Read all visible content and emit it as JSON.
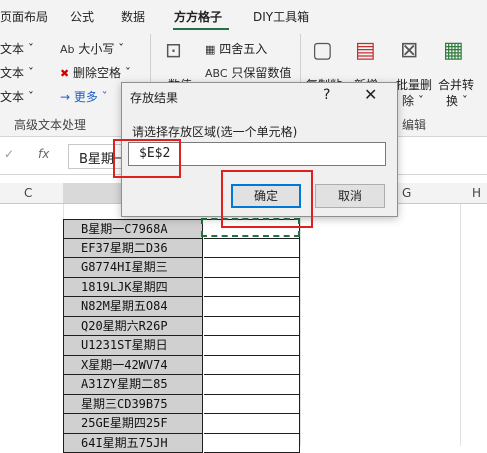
{
  "ribbon_tabs": [
    {
      "label": "页面布局"
    },
    {
      "label": "公式"
    },
    {
      "label": "数据"
    },
    {
      "label": "方方格子"
    },
    {
      "label": "DIY工具箱"
    }
  ],
  "ribbon": {
    "text_left": [
      "文本 ˇ",
      "文本 ˇ",
      "文本 ˇ"
    ],
    "case_btn": "大小写 ˇ",
    "case_icon": "Ab",
    "delete_space": "删除空格 ˇ",
    "more": "→ 更多 ˇ",
    "round_btn": "四舍五入",
    "keep_value": "只保留数值",
    "numeric_label": "数值",
    "copy_paste_label": "复制粘",
    "new_label": "新增",
    "batch_delete": "批量删",
    "batch_delete2": "除 ˇ",
    "merge_convert": "合并转",
    "merge_convert2": "换 ˇ",
    "group_text": "高级文本处理",
    "group_edit": "编辑"
  },
  "formula_bar": {
    "name_box": "",
    "fx_label": "fx",
    "content": "B星期一"
  },
  "columns": [
    "C",
    "G",
    "H"
  ],
  "cells": [
    "B星期一C7968A",
    "EF37星期二D36",
    "G8774HI星期三",
    "1819LJK星期四",
    "N82M星期五O84",
    "Q20星期六R26P",
    "U1231ST星期日",
    "X星期一42WV74",
    "A31ZY星期二85",
    "星期三CD39B75",
    "25GE星期四25F",
    "64I星期五75JH"
  ],
  "dialog": {
    "title": "存放结果",
    "help": "?",
    "close": "✕",
    "prompt": "请选择存放区域(选一个单元格)",
    "input_value": "$E$2",
    "ok_label": "确定",
    "cancel_label": "取消"
  },
  "colors": {
    "accent_green": "#217346",
    "highlight_red": "#e02020",
    "button_focus": "#0078d7"
  }
}
